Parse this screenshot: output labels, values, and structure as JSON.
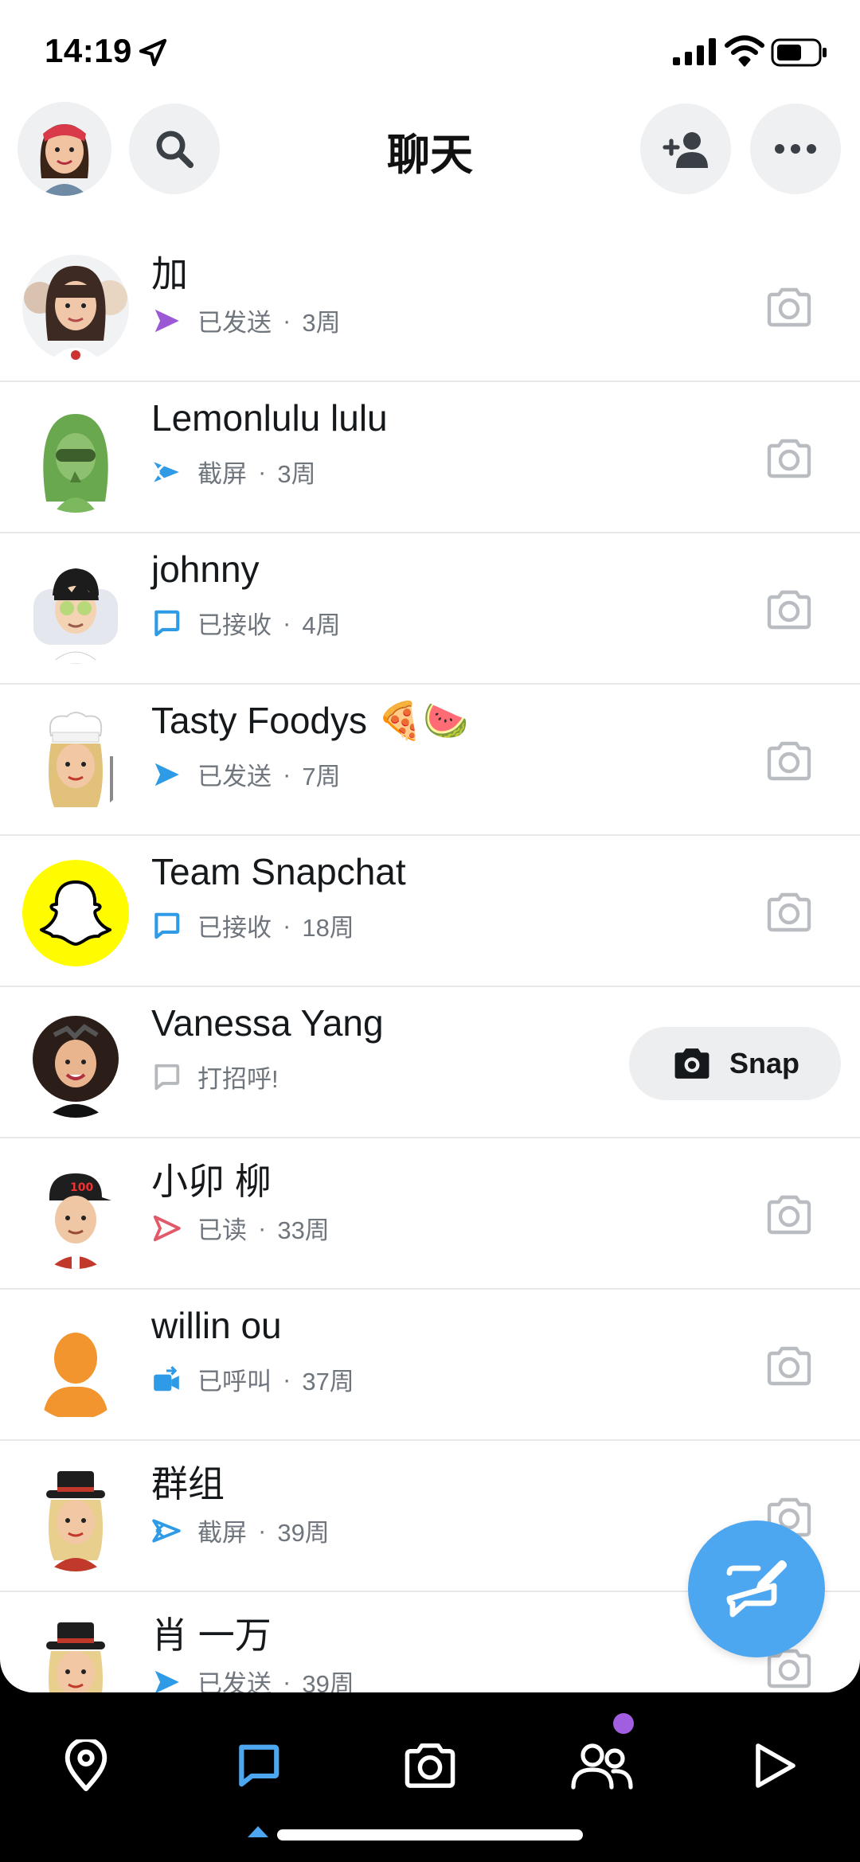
{
  "status_bar": {
    "time": "14:19"
  },
  "header": {
    "title": "聊天"
  },
  "chats": [
    {
      "name": "加",
      "status": "已发送",
      "time": "3周",
      "status_icon": "sent-arrow-icon",
      "status_color": "#9b59d6"
    },
    {
      "name": "Lemonlulu lulu",
      "status": "截屏",
      "time": "3周",
      "status_icon": "screenshot-icon",
      "status_color": "#2f9be6"
    },
    {
      "name": "johnny",
      "status": "已接收",
      "time": "4周",
      "status_icon": "received-chat-icon",
      "status_color": "#2f9be6"
    },
    {
      "name": "Tasty Foodys 🍕🍉",
      "status": "已发送",
      "time": "7周",
      "status_icon": "sent-arrow-icon",
      "status_color": "#2f9be6"
    },
    {
      "name": "Team Snapchat",
      "status": "已接收",
      "time": "18周",
      "status_icon": "received-chat-icon",
      "status_color": "#2f9be6"
    },
    {
      "name": "Vanessa Yang",
      "status": "打招呼!",
      "time": "",
      "status_icon": "empty-chat-icon",
      "status_color": "#b5b9be",
      "action_label": "Snap"
    },
    {
      "name": "小卯 柳",
      "status": "已读",
      "time": "33周",
      "status_icon": "opened-arrow-icon",
      "status_color": "#e05a6a"
    },
    {
      "name": "willin ou",
      "status": "已呼叫",
      "time": "37周",
      "status_icon": "video-call-icon",
      "status_color": "#2f9be6"
    },
    {
      "name": "群组",
      "status": "截屏",
      "time": "39周",
      "status_icon": "screenshot-icon",
      "status_color": "#2f9be6"
    },
    {
      "name": "肖 一万",
      "status": "已发送",
      "time": "39周",
      "status_icon": "sent-arrow-icon",
      "status_color": "#2f9be6"
    }
  ],
  "nav": {
    "items": [
      "map-pin-icon",
      "chat-icon",
      "camera-icon",
      "friends-icon",
      "stories-play-icon"
    ],
    "active": "chat-icon"
  },
  "colors": {
    "accent": "#4da6f0",
    "snapchat_yellow": "#FFFC00",
    "notification": "#a25ee0"
  }
}
